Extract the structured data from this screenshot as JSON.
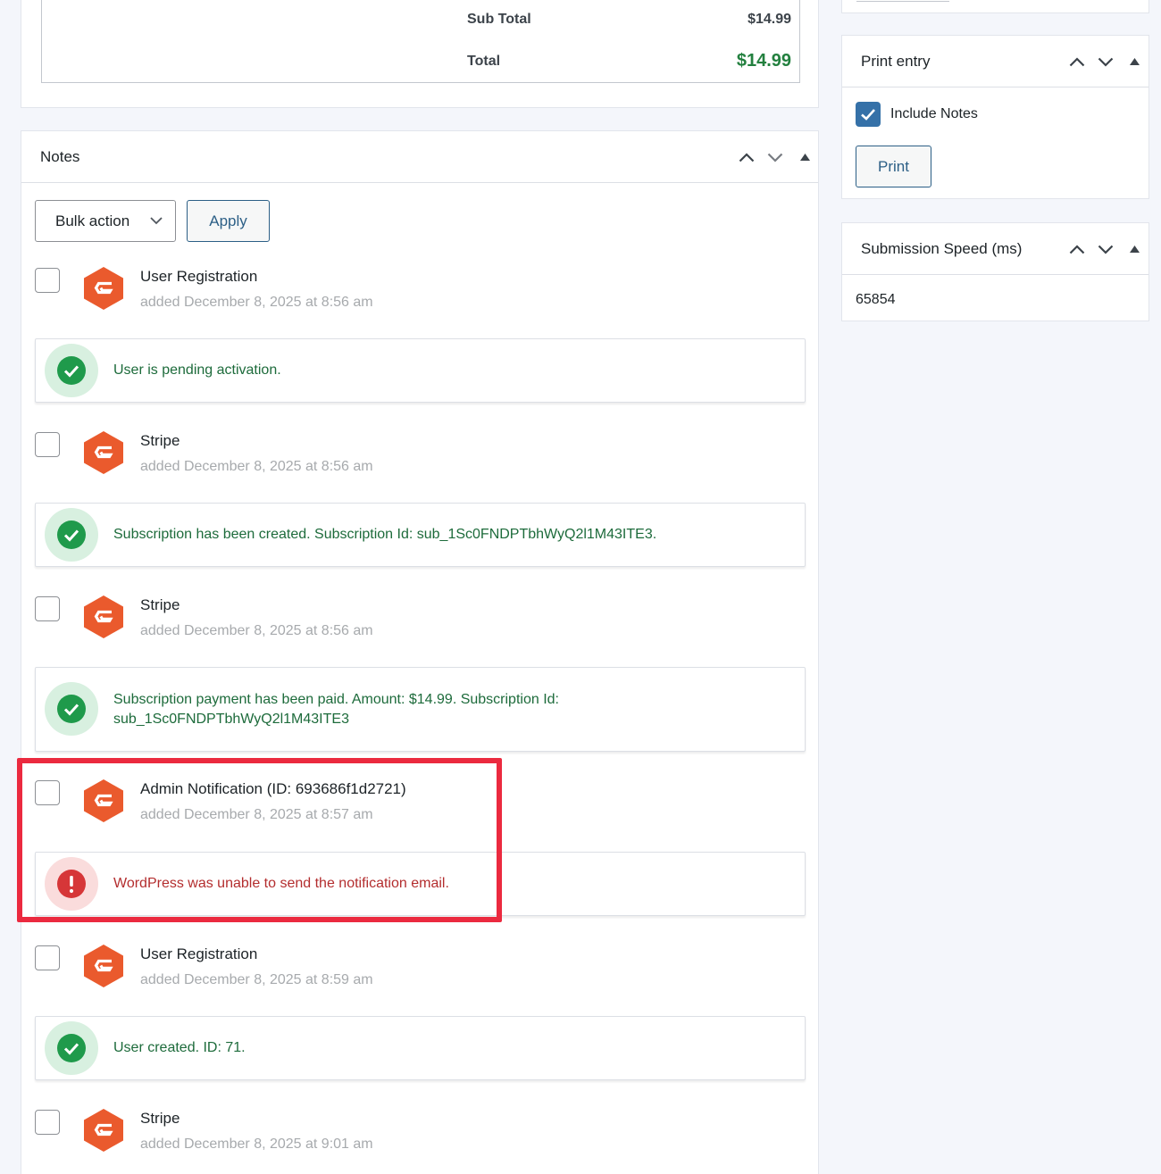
{
  "totals": {
    "sub_total_label": "Sub Total",
    "sub_total_value": "$14.99",
    "total_label": "Total",
    "total_value": "$14.99"
  },
  "notes": {
    "title": "Notes",
    "bulk_action_label": "Bulk action",
    "apply_label": "Apply",
    "items": [
      {
        "author": "User Registration",
        "date": "added December 8, 2025 at 8:56 am",
        "status": "success",
        "message": [
          "User is pending activation."
        ]
      },
      {
        "author": "Stripe",
        "date": "added December 8, 2025 at 8:56 am",
        "status": "success",
        "message": [
          "Subscription has been created. Subscription Id: sub_1Sc0FNDPTbhWyQ2l1M43ITE3."
        ]
      },
      {
        "author": "Stripe",
        "date": "added December 8, 2025 at 8:56 am",
        "status": "success",
        "message": [
          "Subscription payment has been paid. Amount: $14.99. Subscription Id:",
          "sub_1Sc0FNDPTbhWyQ2l1M43ITE3"
        ]
      },
      {
        "author": "Admin Notification (ID: 693686f1d2721)",
        "date": "added December 8, 2025 at 8:57 am",
        "status": "error",
        "message": [
          "WordPress was unable to send the notification email."
        ]
      },
      {
        "author": "User Registration",
        "date": "added December 8, 2025 at 8:59 am",
        "status": "success",
        "message": [
          "User created. ID: 71."
        ]
      },
      {
        "author": "Stripe",
        "date": "added December 8, 2025 at 9:01 am",
        "status": "success",
        "message": []
      }
    ]
  },
  "print_entry": {
    "title": "Print entry",
    "include_notes_label": "Include Notes",
    "include_notes_checked": true,
    "print_label": "Print"
  },
  "submission_speed": {
    "title": "Submission Speed (ms)",
    "value": "65854"
  },
  "colors": {
    "success": "#1d6b3b",
    "error": "#b32d2e",
    "highlight": "#eb2a3f",
    "accent": "#2c5f86",
    "brand": "#ea5a2d"
  },
  "icons": {
    "avatar": "gravity-forms-logo-icon",
    "success": "check-circle-icon",
    "error": "exclamation-circle-icon"
  }
}
